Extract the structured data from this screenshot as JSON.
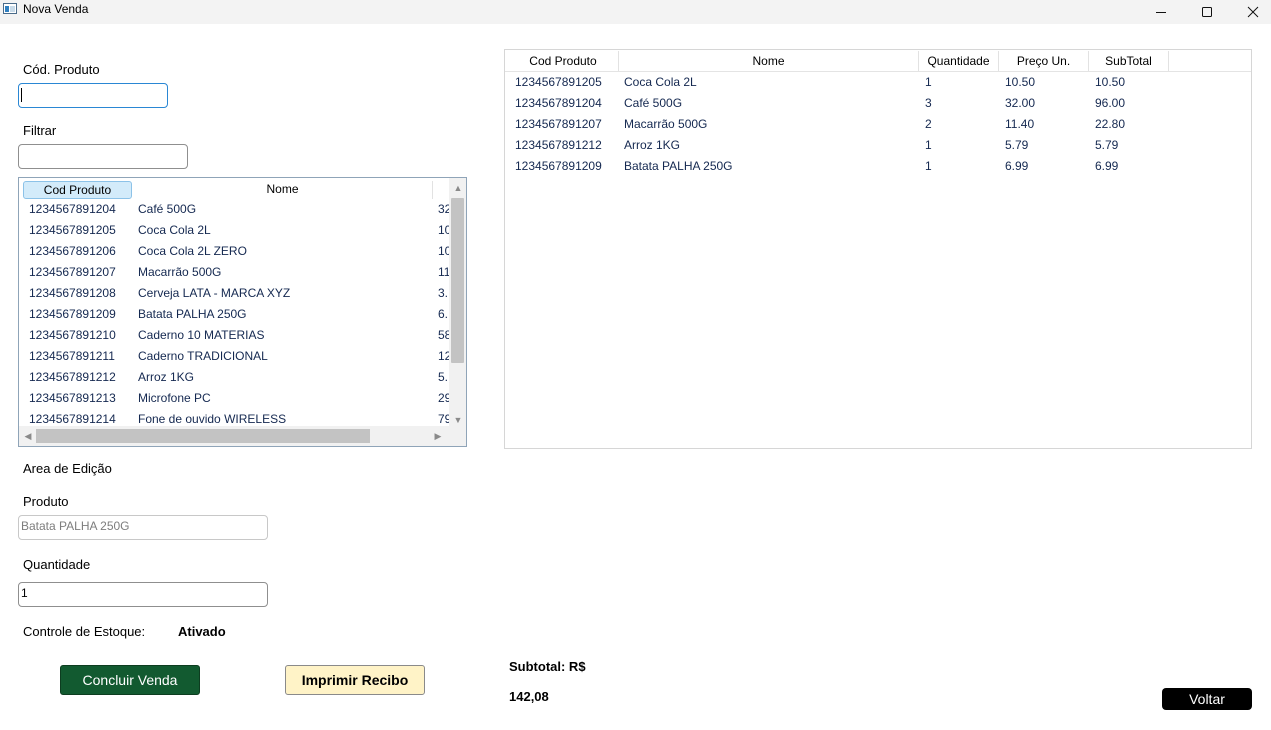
{
  "window": {
    "title": "Nova Venda",
    "app_icon": "app-window-icon",
    "controls": [
      "minimize-icon",
      "maximize-icon",
      "close-icon"
    ]
  },
  "left": {
    "cod_label": "Cód. Produto",
    "cod_value": "",
    "filter_label": "Filtrar",
    "filter_value": "",
    "products": {
      "columns": [
        "Cod Produto",
        "Nome",
        ""
      ],
      "sorted_column": "Cod Produto",
      "rows": [
        {
          "cod": "1234567891204",
          "nome": "Café 500G",
          "extra": "32"
        },
        {
          "cod": "1234567891205",
          "nome": "Coca Cola 2L",
          "extra": "10"
        },
        {
          "cod": "1234567891206",
          "nome": "Coca Cola 2L ZERO",
          "extra": "10"
        },
        {
          "cod": "1234567891207",
          "nome": "Macarrão 500G",
          "extra": "11"
        },
        {
          "cod": "1234567891208",
          "nome": "Cerveja LATA - MARCA XYZ",
          "extra": "3."
        },
        {
          "cod": "1234567891209",
          "nome": "Batata PALHA 250G",
          "extra": "6."
        },
        {
          "cod": "1234567891210",
          "nome": "Caderno 10 MATERIAS",
          "extra": "58"
        },
        {
          "cod": "1234567891211",
          "nome": "Caderno TRADICIONAL",
          "extra": "12"
        },
        {
          "cod": "1234567891212",
          "nome": "Arroz 1KG",
          "extra": "5."
        },
        {
          "cod": "1234567891213",
          "nome": "Microfone PC",
          "extra": "29"
        },
        {
          "cod": "1234567891214",
          "nome": "Fone de ouvido WIRELESS",
          "extra": "79"
        }
      ]
    },
    "edit_area_label": "Area de Edição",
    "produto_label": "Produto",
    "produto_value": "Batata PALHA 250G",
    "quantidade_label": "Quantidade",
    "quantidade_value": "1",
    "estoque_label": "Controle de Estoque:",
    "estoque_value": "Ativado",
    "concluir_label": "Concluir Venda",
    "imprimir_label": "Imprimir Recibo"
  },
  "right": {
    "items": {
      "columns": [
        "Cod Produto",
        "Nome",
        "Quantidade",
        "Preço Un.",
        "SubTotal"
      ],
      "rows": [
        {
          "cod": "1234567891205",
          "nome": "Coca Cola 2L",
          "qtd": "1",
          "preco": "10.50",
          "subtotal": "10.50"
        },
        {
          "cod": "1234567891204",
          "nome": "Café 500G",
          "qtd": "3",
          "preco": "32.00",
          "subtotal": "96.00"
        },
        {
          "cod": "1234567891207",
          "nome": "Macarrão 500G",
          "qtd": "2",
          "preco": "11.40",
          "subtotal": "22.80"
        },
        {
          "cod": "1234567891212",
          "nome": "Arroz 1KG",
          "qtd": "1",
          "preco": "5.79",
          "subtotal": "5.79"
        },
        {
          "cod": "1234567891209",
          "nome": "Batata PALHA 250G",
          "qtd": "1",
          "preco": "6.99",
          "subtotal": "6.99"
        }
      ]
    },
    "subtotal_label": "Subtotal: R$",
    "subtotal_value": "142,08",
    "voltar_label": "Voltar"
  },
  "colors": {
    "primary_button": "#125a30",
    "secondary_button": "#fff3c7",
    "back_button": "#000000",
    "sorted_header": "#d3ebfa",
    "row_text": "#142850"
  }
}
